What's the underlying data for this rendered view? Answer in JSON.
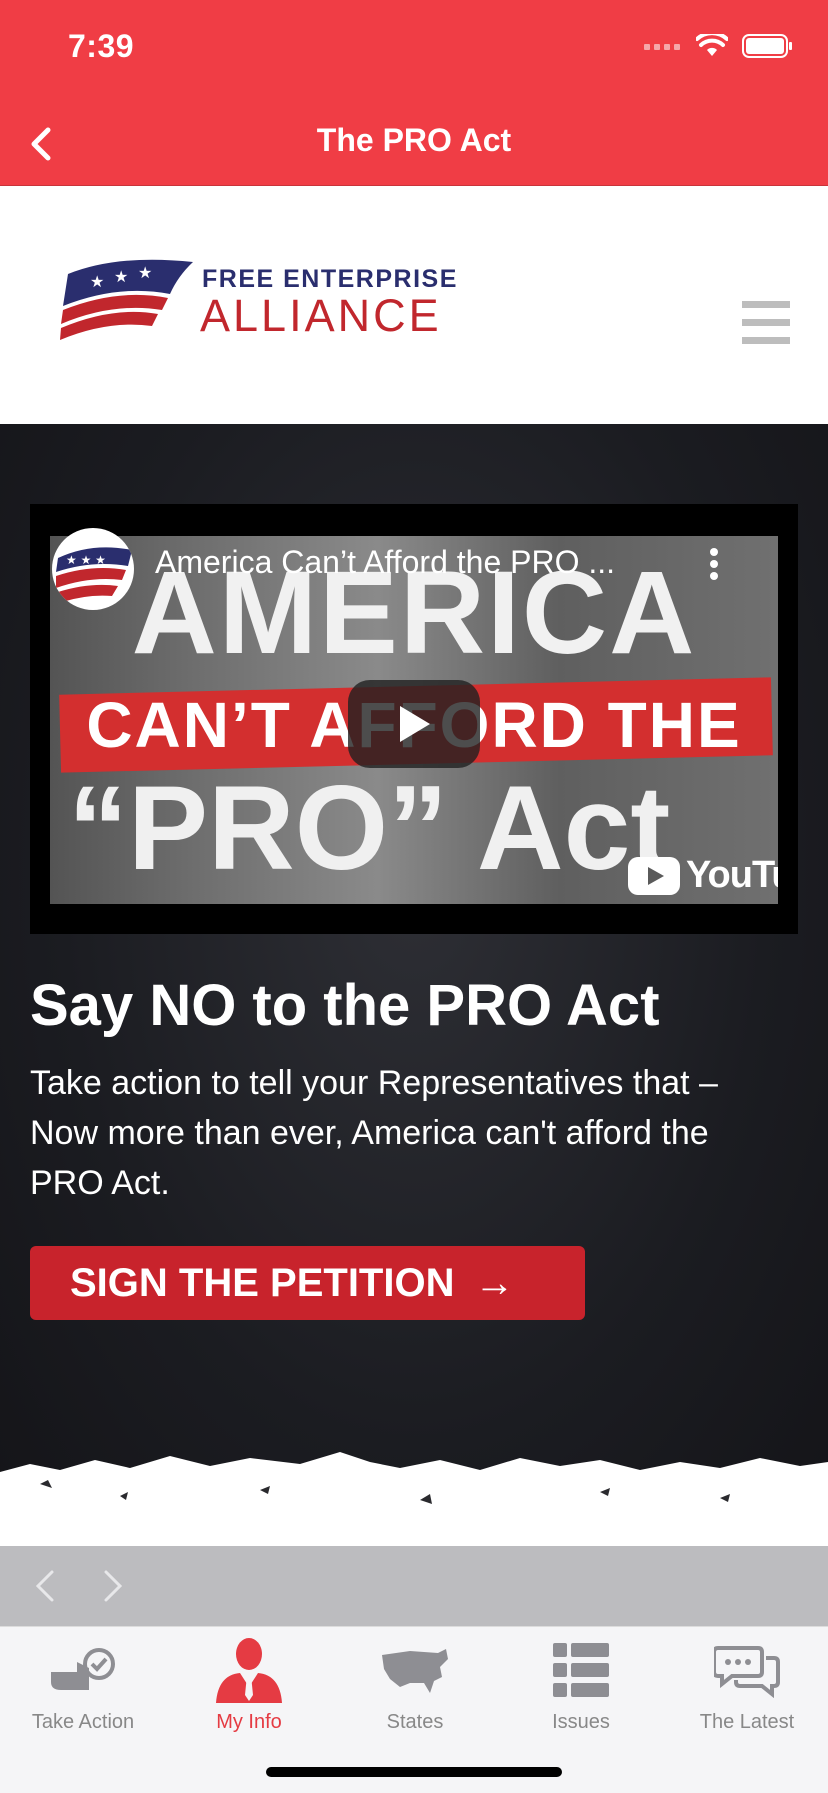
{
  "status_bar": {
    "time": "7:39"
  },
  "nav": {
    "title": "The PRO Act",
    "back_icon": "chevron-left-icon"
  },
  "header": {
    "logo_line1": "FREE ENTERPRISE",
    "logo_line2": "ALLIANCE",
    "menu_icon": "hamburger-icon"
  },
  "video": {
    "title": "America Can’t Afford the PRO ...",
    "thumbnail_line1": "AMERICA",
    "thumbnail_line2": "CAN’T AFFORD THE",
    "thumbnail_line3": "“PRO” Act",
    "provider": "YouTube"
  },
  "content": {
    "heading": "Say NO to the PRO Act",
    "body": "Take action to tell your Representatives that – Now more than ever, America can't afford the PRO Act.",
    "cta_label": "SIGN THE PETITION",
    "cta_arrow": "→"
  },
  "browser_bar": {
    "back_icon": "chevron-left-icon",
    "forward_icon": "chevron-right-icon"
  },
  "tabs": [
    {
      "label": "Take Action",
      "icon": "take-action-icon",
      "active": false
    },
    {
      "label": "My Info",
      "icon": "person-icon",
      "active": true
    },
    {
      "label": "States",
      "icon": "us-map-icon",
      "active": false
    },
    {
      "label": "Issues",
      "icon": "list-icon",
      "active": false
    },
    {
      "label": "The Latest",
      "icon": "chat-bubbles-icon",
      "active": false
    }
  ],
  "colors": {
    "brand_red": "#f03d45",
    "cta_red": "#c8232c",
    "navy": "#2a2e6e",
    "tab_active": "#e53b43"
  }
}
